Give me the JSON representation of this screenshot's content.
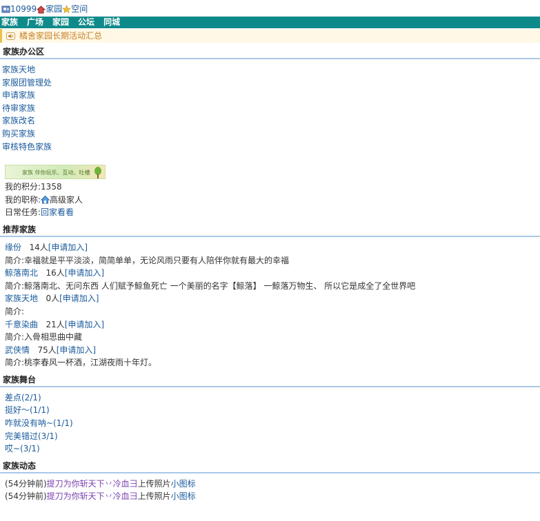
{
  "topbar": {
    "num": "10999",
    "home": "家园",
    "space": "空间"
  },
  "nav": [
    "家族",
    "广场",
    "家园",
    "公坛",
    "同城"
  ],
  "notice": "橘舍家园长期活动汇总",
  "office": {
    "title": "家族办公区",
    "links": [
      "家族天地",
      "家服团管理处",
      "申请家族",
      "待审家族",
      "家族改名",
      "购买家族",
      "审核特色家族"
    ],
    "banner_text": "家族 伴你玩乐、互动、吐槽",
    "score_label": "我的积分:",
    "score": "1358",
    "title_label": "我的职称:",
    "rank": "高级家人",
    "task_label": "日常任务:",
    "task_link": "回家看看"
  },
  "recommend": {
    "title": "推荐家族",
    "families": [
      {
        "name": "缘份",
        "count": "14人",
        "join": "[申请加入]",
        "intro": "简介:幸福就是平平淡淡，简简单单，无论风雨只要有人陪伴你就有最大的幸福"
      },
      {
        "name": "鲸落南北",
        "count": "16人",
        "join": "[申请加入]",
        "intro": "简介:鲸落南北、无问东西 人们赋予鲸鱼死亡 一个美丽的名字【鲸落】 一鲸落万物生、 所以它是成全了全世界吧"
      },
      {
        "name": "家族天地",
        "count": "0人",
        "join": "[申请加入]",
        "intro": "简介:"
      },
      {
        "name": "千意染曲",
        "count": "21人",
        "join": "[申请加入]",
        "intro": "简介:入骨相思曲中藏"
      },
      {
        "name": "武侠情",
        "count": "75人",
        "join": "[申请加入]",
        "intro": "简介:桃李春风一杯酒，江湖夜雨十年灯。"
      }
    ]
  },
  "stage": {
    "title": "家族舞台",
    "items": [
      "差点(2/1)",
      "挺好～(1/1)",
      "咋就没有呐~(1/1)",
      "完美错过(3/1)",
      "哎~(3/1)"
    ]
  },
  "news": {
    "title": "家族动态",
    "items": [
      {
        "time": "(54分钟前)",
        "user": "提刀为你斩天下丷冷血彐",
        "action": "上传照片",
        "link": "小图标"
      },
      {
        "time": "(54分钟前)",
        "user": "提刀为你斩天下丷冷血彐",
        "action": "上传照片",
        "link": "小图标"
      }
    ]
  }
}
